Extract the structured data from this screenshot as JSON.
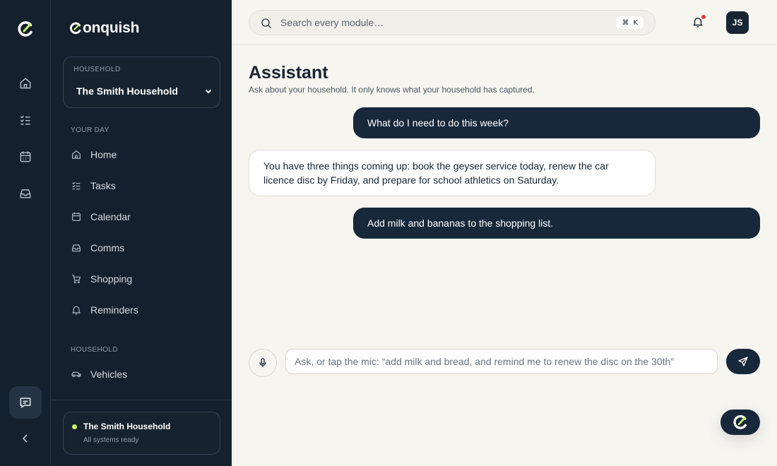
{
  "brand": {
    "name": "onquish"
  },
  "colors": {
    "accent": "#c7f36a",
    "dark": "#14202e",
    "bubble": "#17283a",
    "alert": "#e53935"
  },
  "rail": {
    "icons": [
      "home-icon",
      "tasks-icon",
      "calendar-icon",
      "inbox-icon",
      "chat-icon",
      "chevron-left-icon"
    ]
  },
  "household_select": {
    "caption": "HOUSEHOLD",
    "value": "The Smith Household"
  },
  "sidebar": {
    "section_your_day": "YOUR DAY",
    "items": [
      {
        "label": "Home",
        "icon": "home-icon"
      },
      {
        "label": "Tasks",
        "icon": "tasks-icon"
      },
      {
        "label": "Calendar",
        "icon": "calendar-icon"
      },
      {
        "label": "Comms",
        "icon": "inbox-icon"
      },
      {
        "label": "Shopping",
        "icon": "cart-icon"
      },
      {
        "label": "Reminders",
        "icon": "bell-icon"
      }
    ],
    "section_household": "HOUSEHOLD",
    "household_items": [
      {
        "label": "Vehicles",
        "icon": "car-icon"
      }
    ]
  },
  "status": {
    "title": "The Smith Household",
    "subtitle": "All systems ready"
  },
  "search": {
    "placeholder": "Search every module…",
    "shortcut_mod": "⌘",
    "shortcut_key": "K"
  },
  "user": {
    "initials": "JS"
  },
  "page": {
    "title": "Assistant",
    "subtitle": "Ask about your household. It only knows what your household has captured."
  },
  "messages": [
    {
      "role": "user",
      "text": "What do I need to do this week?"
    },
    {
      "role": "assistant",
      "text": "You have three things coming up: book the geyser service today, renew the car licence disc by Friday, and prepare for school athletics on Saturday."
    },
    {
      "role": "user",
      "text": "Add milk and bananas to the shopping list."
    }
  ],
  "composer": {
    "placeholder": "Ask, or tap the mic: “add milk and bread, and remind me to renew the disc on the 30th”"
  }
}
